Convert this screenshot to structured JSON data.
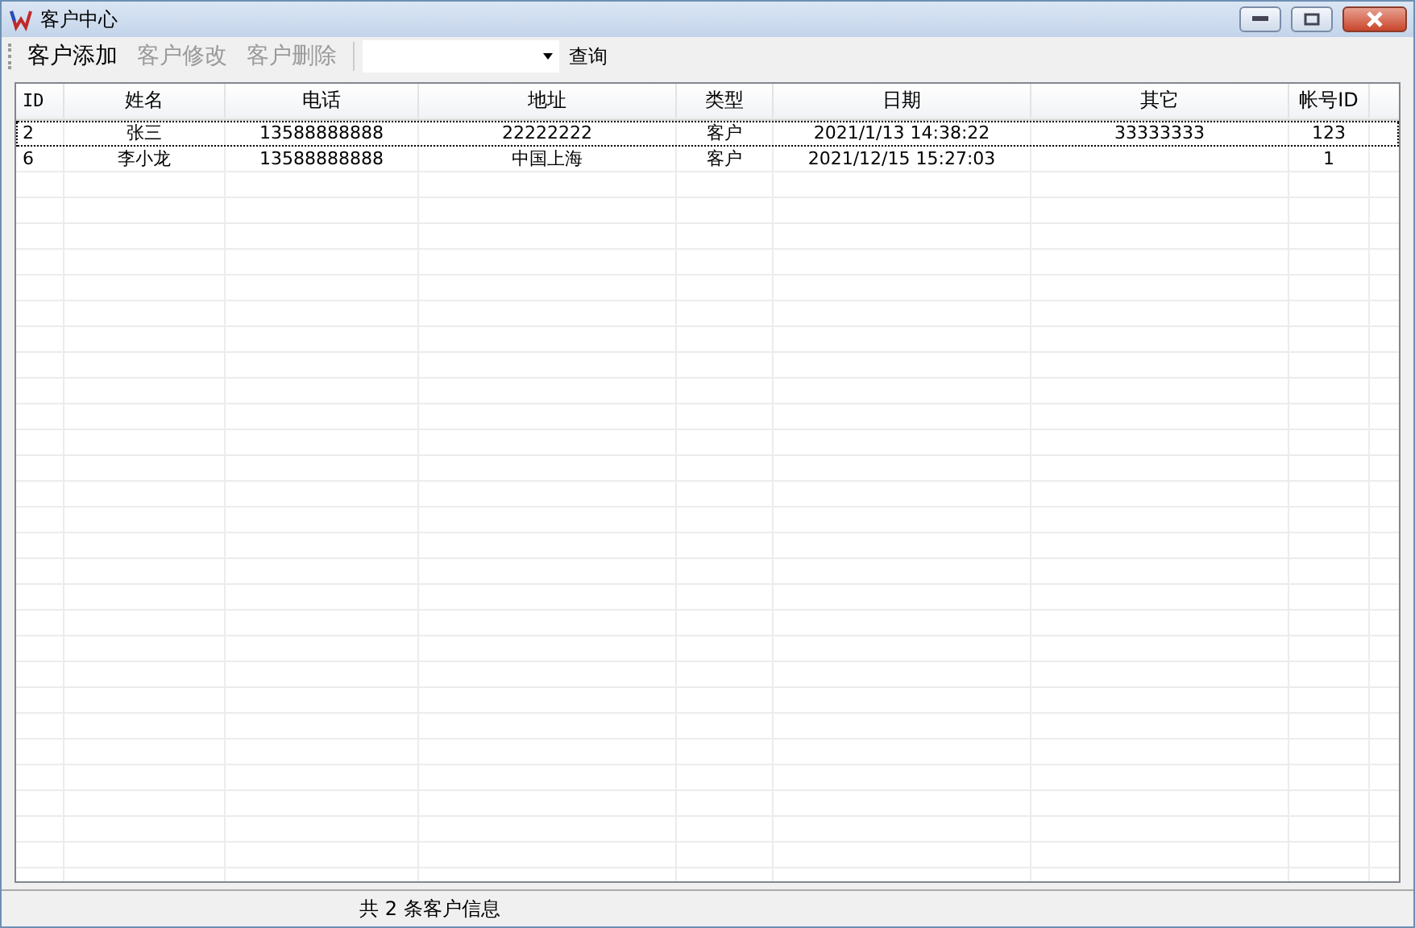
{
  "window": {
    "title": "客户中心"
  },
  "toolbar": {
    "buttons": [
      {
        "label": "客户添加",
        "disabled": false
      },
      {
        "label": "客户修改",
        "disabled": true
      },
      {
        "label": "客户删除",
        "disabled": true
      }
    ],
    "search_button": "查询"
  },
  "table": {
    "columns": [
      "ID",
      "姓名",
      "电话",
      "地址",
      "类型",
      "日期",
      "其它",
      "帐号ID"
    ],
    "rows": [
      {
        "selected": true,
        "cells": [
          "2",
          "张三",
          "13588888888",
          "22222222",
          "客户",
          "2021/1/13 14:38:22",
          "33333333",
          "123"
        ]
      },
      {
        "selected": false,
        "cells": [
          "6",
          "李小龙",
          "13588888888",
          "中国上海",
          "客户",
          "2021/12/15 15:27:03",
          "",
          "1"
        ]
      }
    ]
  },
  "status_bar": "共 2 条客户信息"
}
